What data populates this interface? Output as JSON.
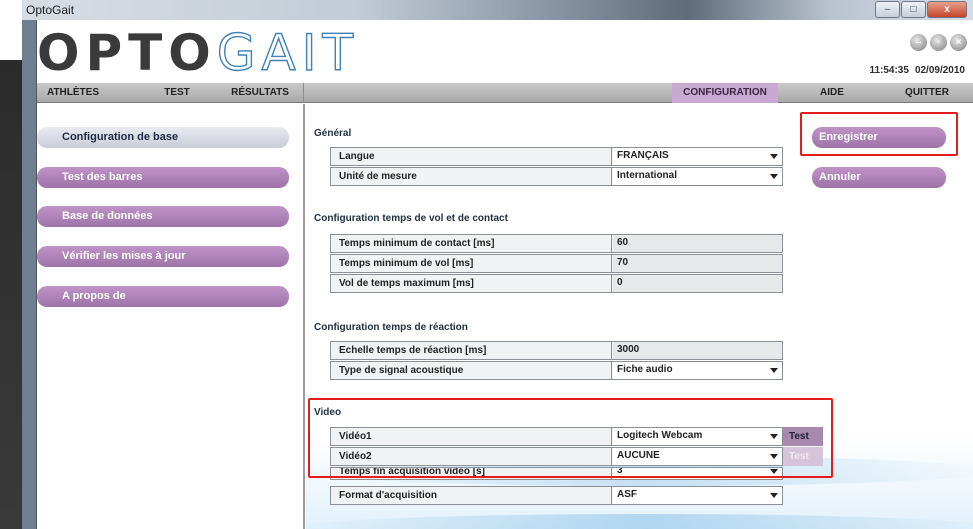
{
  "window": {
    "title": "OptoGait",
    "controls": {
      "minimize": "–",
      "maximize": "□",
      "close": "x"
    }
  },
  "header": {
    "logo_part1": "OPTO",
    "logo_part2": "GAIT",
    "time": "11:54:35",
    "date": "02/09/2010",
    "icons": [
      "minimize-round-icon",
      "restore-round-icon",
      "close-round-icon"
    ]
  },
  "nav": {
    "items": [
      {
        "label": "ATHLÈTES"
      },
      {
        "label": "TEST"
      },
      {
        "label": "RÉSULTATS"
      },
      {
        "label": "CONFIGURATION",
        "active": true
      },
      {
        "label": "AIDE"
      },
      {
        "label": "QUITTER"
      }
    ]
  },
  "sidebar": {
    "items": [
      {
        "label": "Configuration de base",
        "active": true
      },
      {
        "label": "Test des barres"
      },
      {
        "label": "Base de données"
      },
      {
        "label": "Vérifier les mises à jour"
      },
      {
        "label": "A propos de"
      }
    ]
  },
  "sections": {
    "general": {
      "title": "Général",
      "rows": [
        {
          "label": "Langue",
          "value": "FRANÇAIS",
          "type": "select"
        },
        {
          "label": "Unité de mesure",
          "value": "International",
          "type": "select"
        }
      ]
    },
    "flight": {
      "title": "Configuration temps de vol et de contact",
      "rows": [
        {
          "label": "Temps minimum de contact [ms]",
          "value": "60"
        },
        {
          "label": "Temps minimum de vol [ms]",
          "value": "70"
        },
        {
          "label": "Vol de temps maximum [ms]",
          "value": "0"
        }
      ]
    },
    "reaction": {
      "title": "Configuration temps de réaction",
      "rows": [
        {
          "label": "Echelle temps de réaction [ms]",
          "value": "3000"
        },
        {
          "label": "Type de signal acoustique",
          "value": "Fiche audio",
          "type": "select"
        }
      ]
    },
    "video": {
      "title": "Video",
      "rows": [
        {
          "label": "Vidéo1",
          "value": "Logitech Webcam",
          "type": "select"
        },
        {
          "label": "Vidéo2",
          "value": "AUCUNE",
          "type": "select"
        },
        {
          "label": "Temps fin acquisition video [s]",
          "value": "3",
          "type": "select"
        },
        {
          "label": "Format d'acquisition",
          "value": "ASF",
          "type": "select"
        }
      ],
      "test1_label": "Test",
      "test2_label": "Test"
    }
  },
  "actions": {
    "save_label": "Enregistrer",
    "cancel_label": "Annuler"
  },
  "colors": {
    "accent_purple": "#a988b0",
    "highlight_red": "#e31d1d",
    "logo_blue": "#3d82b8"
  }
}
